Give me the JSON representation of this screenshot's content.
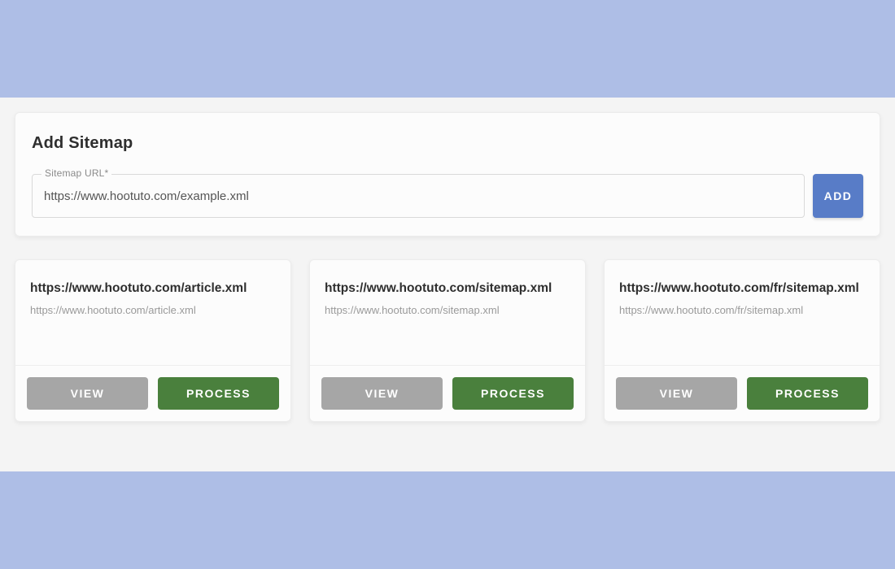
{
  "add": {
    "heading": "Add Sitemap",
    "field_label": "Sitemap URL*",
    "value": "https://www.hootuto.com/example.xml",
    "button": "ADD"
  },
  "buttons": {
    "view": "VIEW",
    "process": "PROCESS"
  },
  "sitemaps": [
    {
      "title": "https://www.hootuto.com/article.xml",
      "sub": "https://www.hootuto.com/article.xml"
    },
    {
      "title": "https://www.hootuto.com/sitemap.xml",
      "sub": "https://www.hootuto.com/sitemap.xml"
    },
    {
      "title": "https://www.hootuto.com/fr/sitemap.xml",
      "sub": "https://www.hootuto.com/fr/sitemap.xml"
    }
  ]
}
